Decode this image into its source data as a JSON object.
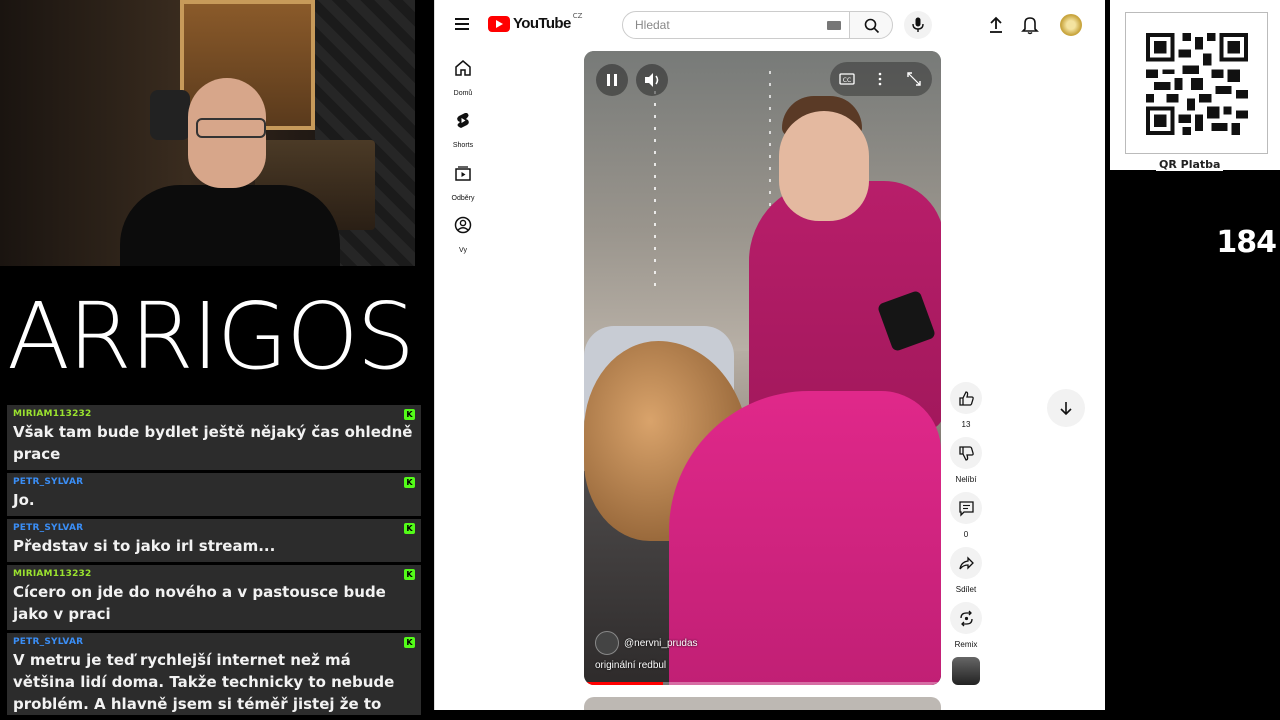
{
  "brand": {
    "logo_text": "ARRIGOS"
  },
  "chat": {
    "messages": [
      {
        "user": "MIRIAM113232",
        "user_color": "#9be32f",
        "text": "Však tam bude bydlet ještě nějaký čas ohledně prace"
      },
      {
        "user": "PETR_SYLVAR",
        "user_color": "#3a8ef6",
        "text": "Jo."
      },
      {
        "user": "PETR_SYLVAR",
        "user_color": "#3a8ef6",
        "text": "Představ si to jako irl stream..."
      },
      {
        "user": "MIRIAM113232",
        "user_color": "#9be32f",
        "text": "Cícero on jde do nového a v pastousce bude jako v praci"
      },
      {
        "user": "PETR_SYLVAR",
        "user_color": "#3a8ef6",
        "text": "V metru je teď rychlejší internet než má většina lidí doma. Takže technicky to nebude problém. A hlavně jsem si téměř jistej že to nikdo neudělal."
      }
    ],
    "badge_color": "#53fc18"
  },
  "youtube": {
    "logo_word": "YouTube",
    "country": "CZ",
    "search_placeholder": "Hledat",
    "nav": [
      {
        "label": "Domů",
        "icon": "home-icon"
      },
      {
        "label": "Shorts",
        "icon": "shorts-icon"
      },
      {
        "label": "Odběry",
        "icon": "subscriptions-icon"
      },
      {
        "label": "Vy",
        "icon": "account-icon"
      }
    ],
    "video": {
      "channel": "@nervni_prudas",
      "sound": "originální redbul",
      "progress": 0.22
    },
    "actions": {
      "like_count": "13",
      "dislike_label": "Nelíbí",
      "comment_count": "0",
      "share_label": "Sdílet",
      "remix_label": "Remix"
    }
  },
  "overlay": {
    "qr_label": "QR Platba",
    "counter": "184"
  }
}
